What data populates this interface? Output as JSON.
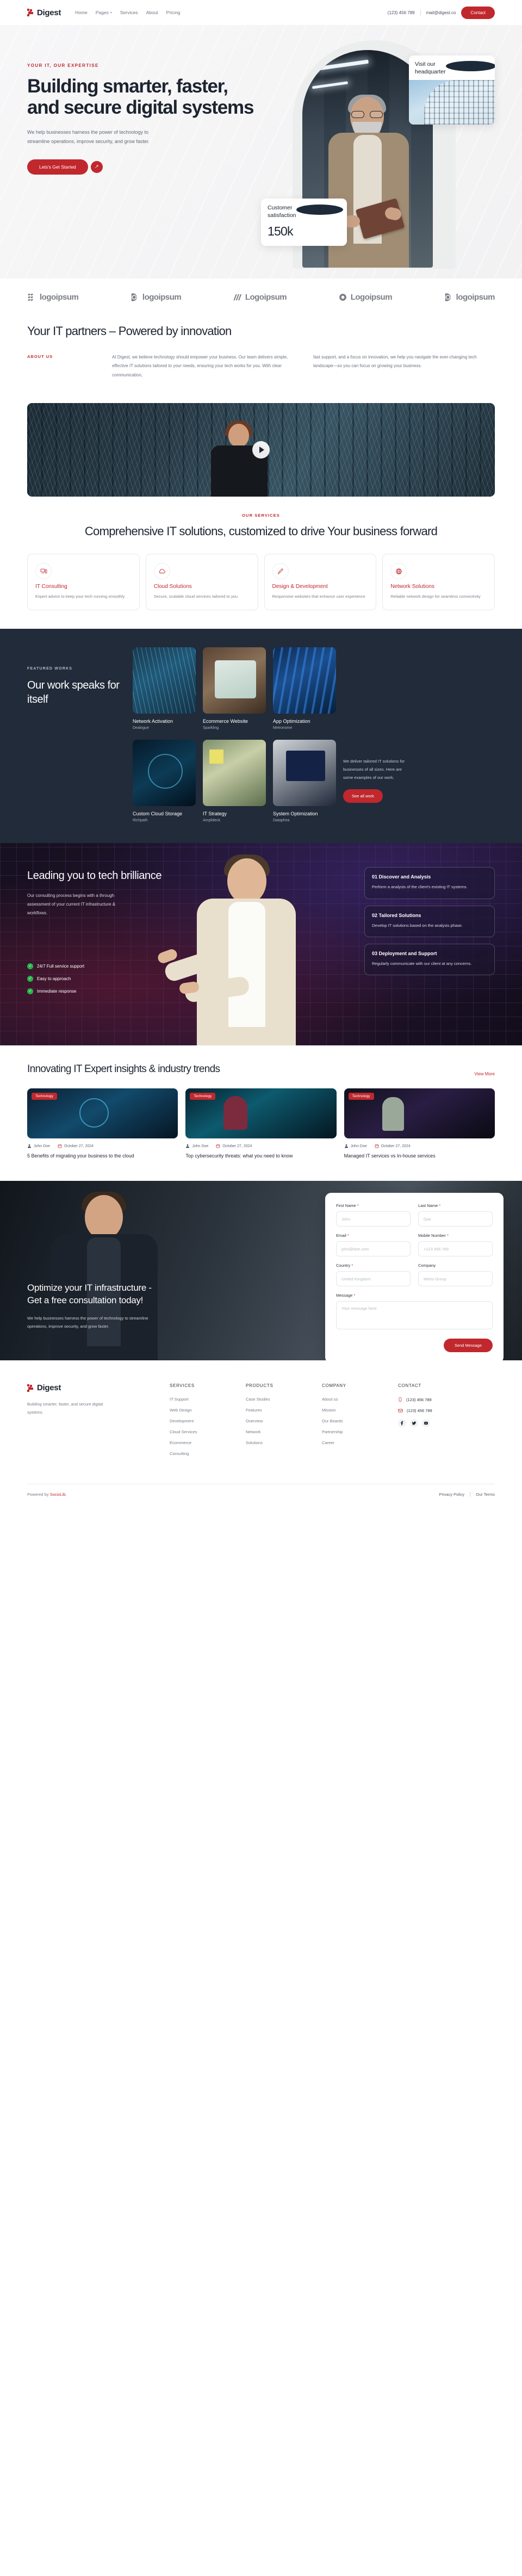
{
  "brand": {
    "name": "Digest"
  },
  "nav": {
    "links": [
      {
        "label": "Home",
        "has_chevron": false
      },
      {
        "label": "Pages",
        "has_chevron": true
      },
      {
        "label": "Services",
        "has_chevron": false
      },
      {
        "label": "About",
        "has_chevron": false
      },
      {
        "label": "Pricing",
        "has_chevron": false
      }
    ],
    "phone": "(123) 456 789",
    "email": "mail@digest.co",
    "contact_button": "Contact"
  },
  "hero": {
    "eyebrow": "YOUR IT, OUR EXPERTISE",
    "title": "Building smarter, faster, and secure digital systems",
    "paragraph": "We help businesses harness the power of technology to streamline operations, improve security, and grow faster.",
    "cta": "Lets's Get Started",
    "card_hq": {
      "title": "Visit our headquarter"
    },
    "card_satisfaction": {
      "title": "Customer satisfaction",
      "value": "150k"
    }
  },
  "logos": [
    {
      "name": "logoipsum",
      "suffix": "•"
    },
    {
      "name": "logoipsum",
      "suffix": "•"
    },
    {
      "name": "Logoipsum",
      "suffix": ""
    },
    {
      "name": "Logoipsum",
      "suffix": ""
    },
    {
      "name": "logoipsum",
      "suffix": "•"
    }
  ],
  "about": {
    "heading": "Your IT partners – Powered by innovation",
    "label": "ABOUT US",
    "col1": "At Digest, we believe technology should empower your business. Our team delivers simple, effective IT solutions tailored to your needs, ensuring your tech works for you. With clear communication,",
    "col2": "fast support, and a focus on innovation, we help you navigate the ever-changing tech landscape—so you can focus on growing your business."
  },
  "services": {
    "label": "OUR SERVICES",
    "heading": "Comprehensive IT solutions, customized to drive Your business forward",
    "cards": [
      {
        "icon": "monitor-icon",
        "title": "IT Consulting",
        "desc": "Expert advice to keep your tech running smoothly"
      },
      {
        "icon": "cloud-icon",
        "title": "Cloud Solutions",
        "desc": "Secure, scalable cloud services tailored to you"
      },
      {
        "icon": "brush-icon",
        "title": "Design & Development",
        "desc": "Responsive websites that enhance user experience"
      },
      {
        "icon": "globe-icon",
        "title": "Network Solutions",
        "desc": "Reliable network design for seamless connectivity"
      }
    ]
  },
  "works": {
    "eyebrow": "FEATURED WORKS",
    "heading": "Our work speaks for itself",
    "note": "We deliver tailored IT solutions for businesses of all sizes. Here are some examples of our work.",
    "button": "See all work",
    "items": [
      {
        "title": "Network Activation",
        "client": "Dealogue"
      },
      {
        "title": "Ecommerce Website",
        "client": "Sparkling"
      },
      {
        "title": "App Optimization",
        "client": "Metronome"
      },
      {
        "title": "Custom Cloud Storage",
        "client": "Richpath"
      },
      {
        "title": "IT Strategy",
        "client": "Amplideck"
      },
      {
        "title": "System Optimization",
        "client": "Dataphea"
      }
    ]
  },
  "tech": {
    "heading": "Leading you to tech brilliance",
    "paragraph": "Our consulting process begins with a through assessment of your current IT infrastructure & workflows.",
    "features": [
      "24/7 Full service support",
      "Easy to approach",
      "Immediate response"
    ],
    "steps": [
      {
        "title": "01 Discover and Analysis",
        "desc": "Perform a analysis of the client's existing IT systems."
      },
      {
        "title": "02 Tailored Solutions",
        "desc": "Develop IT solutions based on the analysis phase."
      },
      {
        "title": "03 Deployment and Support",
        "desc": "Regularly communicate with our client at any concerns."
      }
    ]
  },
  "blog": {
    "heading": "Innovating IT Expert insights & industry trends",
    "view_more": "View More",
    "posts": [
      {
        "badge": "Technology",
        "author": "John Doe",
        "date": "October 27, 2024",
        "title": "5 Benefits of migrating your business to the cloud"
      },
      {
        "badge": "Technology",
        "author": "John Doe",
        "date": "October 27, 2024",
        "title": "Top cybersecurity threats: what you need to know"
      },
      {
        "badge": "Technology",
        "author": "John Doe",
        "date": "October 27, 2024",
        "title": "Managed IT services vs In-house services"
      }
    ]
  },
  "contact": {
    "heading": "Optimize your IT infrastructure - Get a free consultation today!",
    "paragraph": "We help businesses harness the power of technology to streamline operations, improve security, and grow faster.",
    "form": {
      "first_name": {
        "label": "First Name",
        "required": true,
        "placeholder": "John",
        "value": ""
      },
      "last_name": {
        "label": "Last Name",
        "required": true,
        "placeholder": "Doe",
        "value": ""
      },
      "email": {
        "label": "Email",
        "required": true,
        "placeholder": "john@doe.com",
        "value": ""
      },
      "mobile": {
        "label": "Mobile Number",
        "required": true,
        "placeholder": "+123 456 789",
        "value": ""
      },
      "country": {
        "label": "Country",
        "required": true,
        "placeholder": "United Kingdom",
        "value": ""
      },
      "company": {
        "label": "Company",
        "required": false,
        "placeholder": "Metro Group",
        "value": ""
      },
      "message": {
        "label": "Message",
        "required": true,
        "placeholder": "Your message here",
        "value": ""
      },
      "submit": "Send Message"
    }
  },
  "footer": {
    "brand": "Digest",
    "desc": "Building smarter, faster, and secure digital systems.",
    "columns": [
      {
        "title": "SERVICES",
        "links": [
          "IT Support",
          "Web Design",
          "Development",
          "Cloud Services",
          "Ecommerce",
          "Consulting"
        ]
      },
      {
        "title": "PRODUCTS",
        "links": [
          "Case Studies",
          "Features",
          "Overview",
          "Network",
          "Solutions"
        ]
      },
      {
        "title": "COMPANY",
        "links": [
          "About us",
          "Mission",
          "Our Boards",
          "Partnership",
          "Career"
        ]
      }
    ],
    "contact": {
      "title": "CONTACT",
      "phone": "(123) 456 789",
      "email_line": "(123) 456 789",
      "social": [
        "facebook-icon",
        "twitter-icon",
        "youtube-icon"
      ]
    },
    "bottom": {
      "powered_prefix": "Powered by",
      "powered_brand": "SocioLib.",
      "privacy": "Privacy Policy",
      "terms": "Our Terms"
    }
  },
  "colors": {
    "accent": "#c0282d",
    "dark": "#212b3a",
    "ink": "#1d2430"
  }
}
